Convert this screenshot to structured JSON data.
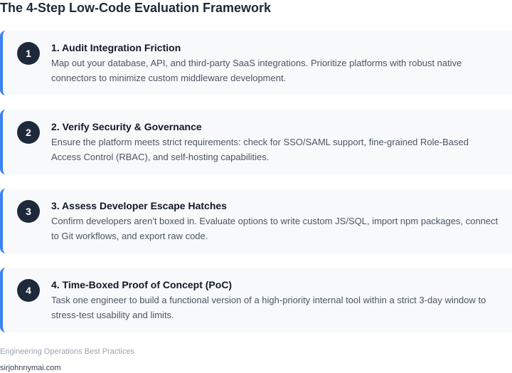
{
  "page": {
    "title": "The 4-Step Low-Code Evaluation Framework"
  },
  "steps": [
    {
      "number": "1",
      "title": "1. Audit Integration Friction",
      "description": "Map out your database, API, and third-party SaaS integrations. Prioritize platforms with robust native connectors to minimize custom middleware development."
    },
    {
      "number": "2",
      "title": "2. Verify Security & Governance",
      "description": "Ensure the platform meets strict requirements: check for SSO/SAML support, fine-grained Role-Based Access Control (RBAC), and self-hosting capabilities."
    },
    {
      "number": "3",
      "title": "3. Assess Developer Escape Hatches",
      "description": "Confirm developers aren't boxed in. Evaluate options to write custom JS/SQL, import npm packages, connect to Git workflows, and export raw code."
    },
    {
      "number": "4",
      "title": "4. Time-Boxed Proof of Concept (PoC)",
      "description": "Task one engineer to build a functional version of a high-priority internal tool within a strict 3-day window to stress-test usability and limits."
    }
  ],
  "footer": {
    "note": "Engineering Operations Best Practices",
    "url": "sirjohnnymai.com"
  },
  "colors": {
    "accent": "#3b82f6",
    "badge": "#1e293b",
    "card_background": "#f8f9fb"
  }
}
